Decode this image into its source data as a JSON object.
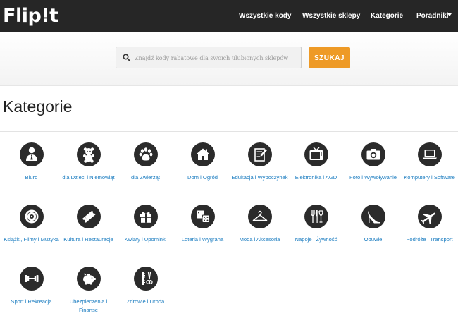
{
  "header": {
    "logo": "Flip!t",
    "nav": [
      "Wszystkie kody",
      "Wszystkie sklepy",
      "Kategorie",
      "Poradniki"
    ]
  },
  "search": {
    "placeholder": "Znajdź kody rabatowe dla swoich ulubionych sklepów",
    "button": "SZUKAJ"
  },
  "page": {
    "title": "Kategorie"
  },
  "categories": [
    {
      "label": "Biuro",
      "icon": "businessman-icon"
    },
    {
      "label": "dla Dzieci i Niemowląt",
      "icon": "teddy-bear-icon"
    },
    {
      "label": "dla Zwierząt",
      "icon": "paw-icon"
    },
    {
      "label": "Dom i Ogród",
      "icon": "house-icon"
    },
    {
      "label": "Edukacja i Wypoczynek",
      "icon": "notepad-icon"
    },
    {
      "label": "Elektronika i AGD",
      "icon": "tv-icon"
    },
    {
      "label": "Foto i Wywoływanie",
      "icon": "camera-icon"
    },
    {
      "label": "Komputery i Software",
      "icon": "laptop-icon"
    },
    {
      "label": "Książki, Filmy i Muzyka",
      "icon": "disc-icon"
    },
    {
      "label": "Kultura i Restauracje",
      "icon": "ticket-icon"
    },
    {
      "label": "Kwiaty i Upominki",
      "icon": "gift-icon"
    },
    {
      "label": "Loteria i Wygrana",
      "icon": "dice-icon"
    },
    {
      "label": "Moda i Akcesoria",
      "icon": "hanger-icon"
    },
    {
      "label": "Napoje i Żywność",
      "icon": "cutlery-icon"
    },
    {
      "label": "Obuwie",
      "icon": "high-heel-icon"
    },
    {
      "label": "Podróże i Transport",
      "icon": "airplane-icon"
    },
    {
      "label": "Sport i Rekreacja",
      "icon": "dumbbell-icon"
    },
    {
      "label": "Ubezpieczenia i Finanse",
      "icon": "piggy-bank-icon"
    },
    {
      "label": "Zdrowie i Uroda",
      "icon": "comb-scissors-icon"
    }
  ]
}
